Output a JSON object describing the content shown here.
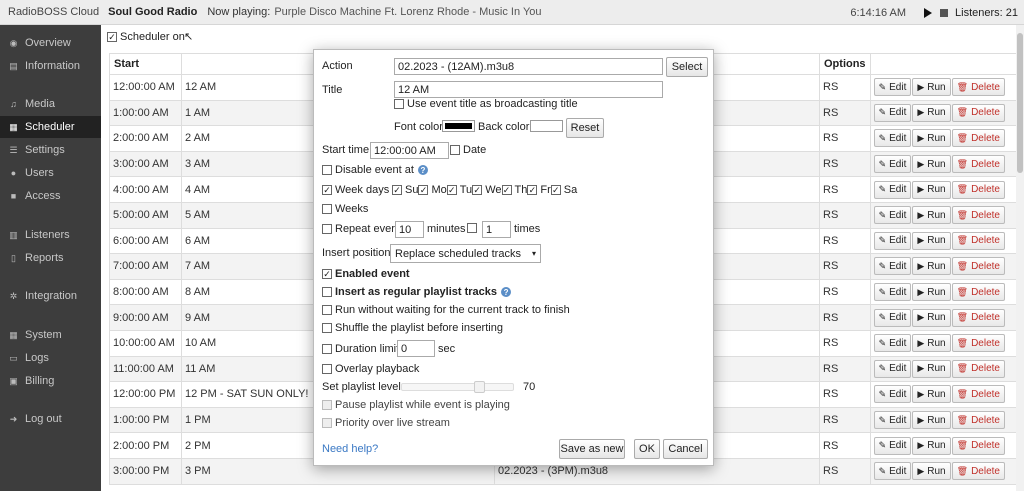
{
  "topbar": {
    "brand": "RadioBOSS Cloud",
    "station": "Soul Good Radio",
    "now_playing_label": "Now playing:",
    "now_playing_track": "Purple Disco Machine Ft. Lorenz Rhode - Music In You",
    "clock": "6:14:16 AM",
    "listeners": "Listeners: 21"
  },
  "sidebar": {
    "items": [
      {
        "label": "Overview",
        "icon": "dashboard-icon"
      },
      {
        "label": "Information",
        "icon": "book-icon"
      },
      {
        "label": "Media",
        "icon": "music-icon"
      },
      {
        "label": "Scheduler",
        "icon": "calendar-icon"
      },
      {
        "label": "Settings",
        "icon": "sliders-icon"
      },
      {
        "label": "Users",
        "icon": "user-icon"
      },
      {
        "label": "Access",
        "icon": "lock-icon"
      },
      {
        "label": "Listeners",
        "icon": "bar-chart-icon"
      },
      {
        "label": "Reports",
        "icon": "file-icon"
      },
      {
        "label": "Integration",
        "icon": "cogs-icon"
      },
      {
        "label": "System",
        "icon": "grid-icon"
      },
      {
        "label": "Logs",
        "icon": "folder-icon"
      },
      {
        "label": "Billing",
        "icon": "money-icon"
      },
      {
        "label": "Log out",
        "icon": "sign-out-icon"
      }
    ]
  },
  "main": {
    "scheduler_on_label": "Scheduler on",
    "columns": {
      "start": "Start",
      "options": "Options"
    },
    "rows": [
      {
        "start": "12:00:00 AM",
        "title": "12 AM",
        "file": "",
        "opt": "RS"
      },
      {
        "start": "1:00:00 AM",
        "title": "1 AM",
        "file": "",
        "opt": "RS"
      },
      {
        "start": "2:00:00 AM",
        "title": "2 AM",
        "file": "",
        "opt": "RS"
      },
      {
        "start": "3:00:00 AM",
        "title": "3 AM",
        "file": "",
        "opt": "RS"
      },
      {
        "start": "4:00:00 AM",
        "title": "4 AM",
        "file": "",
        "opt": "RS"
      },
      {
        "start": "5:00:00 AM",
        "title": "5 AM",
        "file": "",
        "opt": "RS"
      },
      {
        "start": "6:00:00 AM",
        "title": "6 AM",
        "file": "",
        "opt": "RS"
      },
      {
        "start": "7:00:00 AM",
        "title": "7 AM",
        "file": "",
        "opt": "RS"
      },
      {
        "start": "8:00:00 AM",
        "title": "8 AM",
        "file": "",
        "opt": "RS"
      },
      {
        "start": "9:00:00 AM",
        "title": "9 AM",
        "file": "",
        "opt": "RS"
      },
      {
        "start": "10:00:00 AM",
        "title": "10 AM",
        "file": "",
        "opt": "RS"
      },
      {
        "start": "11:00:00 AM",
        "title": "11 AM",
        "file": "",
        "opt": "RS"
      },
      {
        "start": "12:00:00 PM",
        "title": "12 PM - SAT SUN ONLY!",
        "file": "",
        "opt": "RS"
      },
      {
        "start": "1:00:00 PM",
        "title": "1 PM",
        "file": "",
        "opt": "RS"
      },
      {
        "start": "2:00:00 PM",
        "title": "2 PM",
        "file": "",
        "opt": "RS"
      },
      {
        "start": "3:00:00 PM",
        "title": "3 PM",
        "file": "02.2023 - (3PM).m3u8",
        "opt": "RS"
      }
    ],
    "row_buttons": {
      "edit": "Edit",
      "run": "Run",
      "delete": "Delete"
    }
  },
  "dialog": {
    "action_label": "Action",
    "action_value": "02.2023 - (12AM).m3u8",
    "select_btn": "Select",
    "title_label": "Title",
    "title_value": "12 AM",
    "use_event_title": "Use event title as broadcasting title",
    "font_color_label": "Font color",
    "font_color": "#000000",
    "back_color_label": "Back color",
    "back_color": "#ffffff",
    "reset_btn": "Reset",
    "start_time_label": "Start time",
    "start_time_value": "12:00:00 AM",
    "date_label": "Date",
    "disable_event_label": "Disable event at",
    "week_days_label": "Week days",
    "days": [
      "Su",
      "Mo",
      "Tu",
      "We",
      "Th",
      "Fr",
      "Sa"
    ],
    "weeks_label": "Weeks",
    "repeat_every_label": "Repeat every",
    "repeat_every_value": "10",
    "minutes_label": "minutes",
    "times_value": "1",
    "times_label": "times",
    "insert_position_label": "Insert position",
    "insert_position_value": "Replace scheduled tracks",
    "enabled_event": "Enabled event",
    "insert_regular": "Insert as regular playlist tracks",
    "run_without_waiting": "Run without waiting for the current track to finish",
    "shuffle_playlist": "Shuffle the playlist before inserting",
    "duration_limit_label": "Duration limit",
    "duration_limit_value": "0",
    "sec_label": "sec",
    "overlay_playback": "Overlay playback",
    "set_playlist_level": "Set playlist level",
    "playlist_level_value": "70",
    "playlist_level_max": 100,
    "pause_playlist": "Pause playlist while event is playing",
    "priority_live": "Priority over live stream",
    "need_help": "Need help?",
    "save_as_new": "Save as new",
    "ok": "OK",
    "cancel": "Cancel"
  }
}
